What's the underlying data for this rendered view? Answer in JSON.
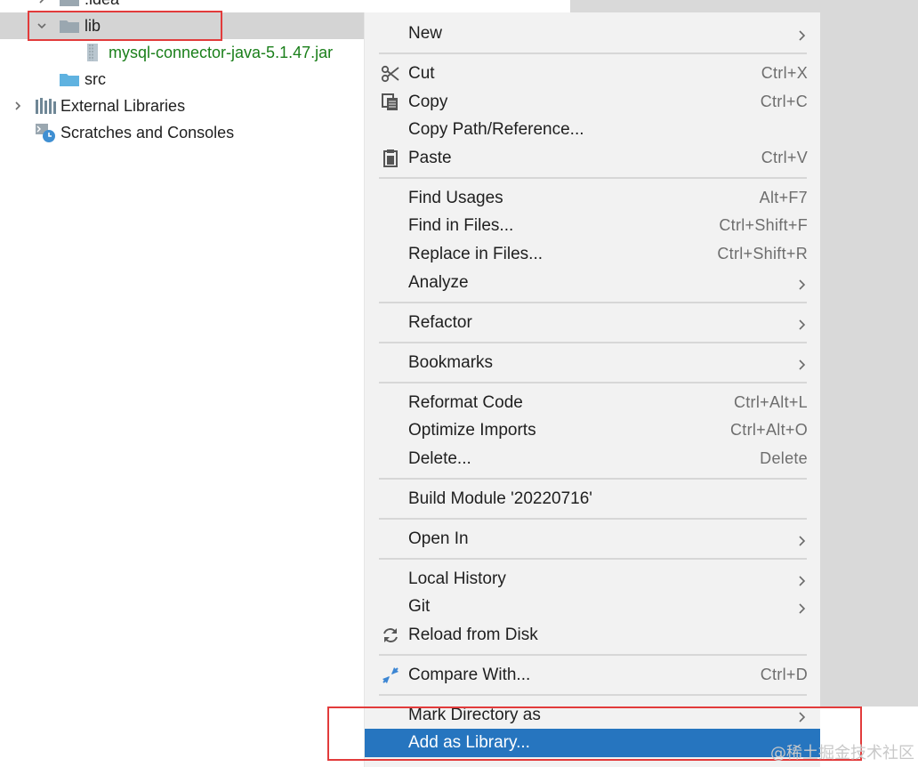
{
  "tree": {
    "items": [
      {
        "label": ".idea"
      },
      {
        "label": "lib"
      },
      {
        "label": "mysql-connector-java-5.1.47.jar"
      },
      {
        "label": "src"
      },
      {
        "label": "External Libraries"
      },
      {
        "label": "Scratches and Consoles"
      }
    ]
  },
  "menu": {
    "new": {
      "label": "New"
    },
    "cut": {
      "label": "Cut",
      "shortcut": "Ctrl+X"
    },
    "copy": {
      "label": "Copy",
      "shortcut": "Ctrl+C"
    },
    "copy_path": {
      "label": "Copy Path/Reference..."
    },
    "paste": {
      "label": "Paste",
      "shortcut": "Ctrl+V"
    },
    "find_usages": {
      "label": "Find Usages",
      "shortcut": "Alt+F7"
    },
    "find_in_files": {
      "label": "Find in Files...",
      "shortcut": "Ctrl+Shift+F"
    },
    "replace_in_files": {
      "label": "Replace in Files...",
      "shortcut": "Ctrl+Shift+R"
    },
    "analyze": {
      "label": "Analyze"
    },
    "refactor": {
      "label": "Refactor"
    },
    "bookmarks": {
      "label": "Bookmarks"
    },
    "reformat": {
      "label": "Reformat Code",
      "shortcut": "Ctrl+Alt+L"
    },
    "optimize": {
      "label": "Optimize Imports",
      "shortcut": "Ctrl+Alt+O"
    },
    "delete": {
      "label": "Delete...",
      "shortcut": "Delete"
    },
    "build_module": {
      "label": "Build Module '20220716'"
    },
    "open_in": {
      "label": "Open In"
    },
    "local_history": {
      "label": "Local History"
    },
    "git": {
      "label": "Git"
    },
    "reload": {
      "label": "Reload from Disk"
    },
    "compare": {
      "label": "Compare With...",
      "shortcut": "Ctrl+D"
    },
    "mark_dir": {
      "label": "Mark Directory as"
    },
    "add_library": {
      "label": "Add as Library..."
    }
  },
  "watermark": "@稀土掘金技术社区",
  "colors": {
    "highlight": "#2675bf",
    "annotation_red": "#e23b3b",
    "jar_green": "#1a7f1a",
    "folder": "#9aa7b0",
    "src_folder": "#5fb2e0"
  }
}
